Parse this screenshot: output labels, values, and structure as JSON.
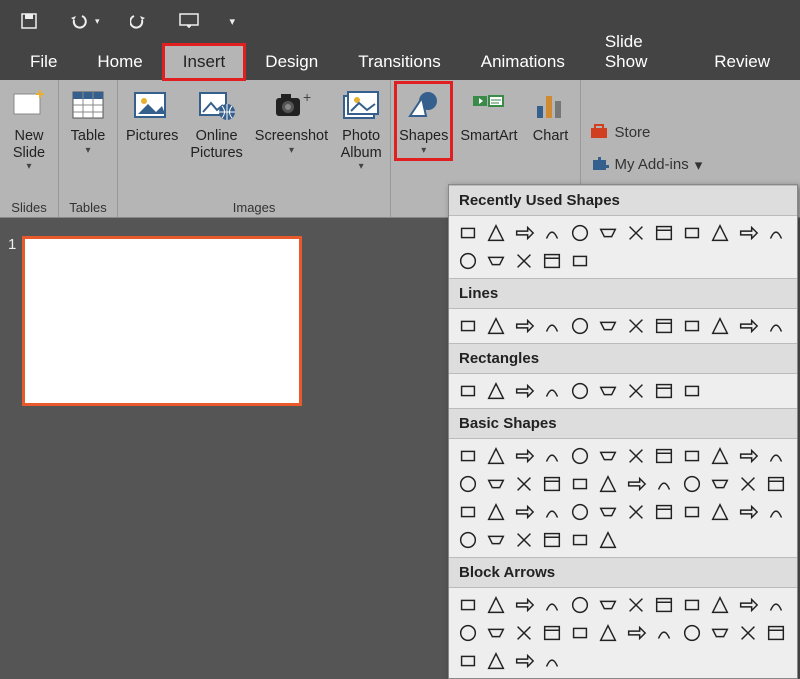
{
  "qat_icons": [
    "save",
    "undo",
    "redo",
    "present",
    "more"
  ],
  "tabs": [
    {
      "label": "File",
      "active": false,
      "highlighted": false
    },
    {
      "label": "Home",
      "active": false,
      "highlighted": false
    },
    {
      "label": "Insert",
      "active": true,
      "highlighted": true
    },
    {
      "label": "Design",
      "active": false,
      "highlighted": false
    },
    {
      "label": "Transitions",
      "active": false,
      "highlighted": false
    },
    {
      "label": "Animations",
      "active": false,
      "highlighted": false
    },
    {
      "label": "Slide Show",
      "active": false,
      "highlighted": false
    },
    {
      "label": "Review",
      "active": false,
      "highlighted": false
    }
  ],
  "ribbon_groups": {
    "slides": {
      "label": "Slides",
      "buttons": [
        {
          "label": "New\nSlide",
          "dropdown": true
        }
      ]
    },
    "tables": {
      "label": "Tables",
      "buttons": [
        {
          "label": "Table",
          "dropdown": true
        }
      ]
    },
    "images": {
      "label": "Images",
      "buttons": [
        {
          "label": "Pictures",
          "dropdown": false
        },
        {
          "label": "Online\nPictures",
          "dropdown": false
        },
        {
          "label": "Screenshot",
          "dropdown": true
        },
        {
          "label": "Photo\nAlbum",
          "dropdown": true
        }
      ]
    },
    "illustrations_ungrouped": [
      {
        "label": "Shapes",
        "dropdown": true,
        "highlighted": true
      },
      {
        "label": "SmartArt",
        "dropdown": false
      },
      {
        "label": "Chart",
        "dropdown": false
      }
    ],
    "addins": [
      {
        "label": "Store",
        "icon": "store"
      },
      {
        "label": "My Add-ins",
        "icon": "addins",
        "dropdown": true
      }
    ]
  },
  "thumbnail": {
    "index": "1"
  },
  "shapes_panel": {
    "categories": [
      {
        "name": "Recently Used Shapes",
        "count": 17
      },
      {
        "name": "Lines",
        "count": 12
      },
      {
        "name": "Rectangles",
        "count": 9
      },
      {
        "name": "Basic Shapes",
        "count": 42
      },
      {
        "name": "Block Arrows",
        "count": 28
      }
    ]
  }
}
